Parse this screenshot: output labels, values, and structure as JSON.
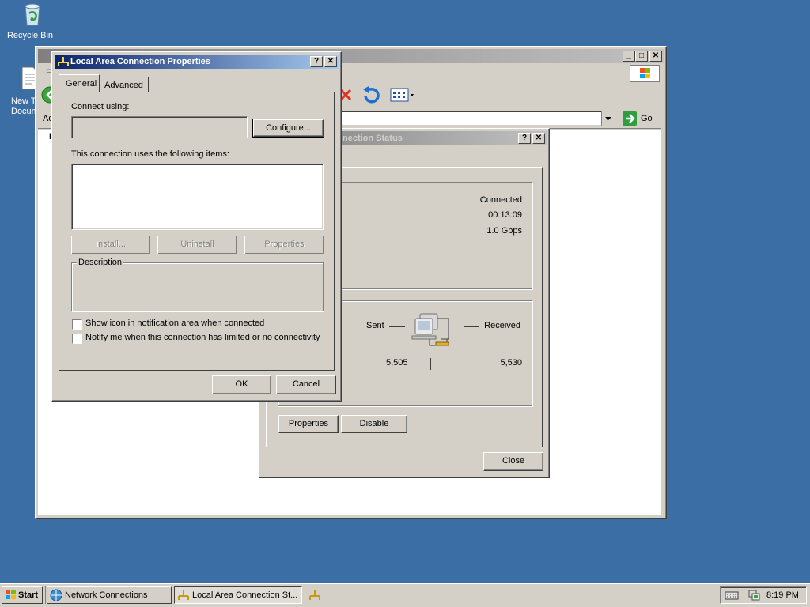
{
  "desktop": {
    "icons": [
      {
        "label": "Recycle Bin",
        "icon": "recycle-bin-icon"
      },
      {
        "label": "New T",
        "label2": "Docum",
        "icon": "text-document-icon"
      }
    ]
  },
  "explorer": {
    "menu_fragment": "Fi",
    "address_fragment": "Ad",
    "list_fragment": "L",
    "go_label": "Go"
  },
  "status_dialog": {
    "title_fragment": "nection Status",
    "connection": {
      "status": "Connected",
      "duration": "00:13:09",
      "speed": "1.0 Gbps"
    },
    "activity": {
      "sent_label": "Sent",
      "received_label": "Received",
      "sent_value": "5,505",
      "received_value": "5,530"
    },
    "buttons": {
      "properties": "Properties",
      "disable": "Disable",
      "close": "Close"
    }
  },
  "properties_dialog": {
    "title": "Local Area Connection Properties",
    "tabs": [
      "General",
      "Advanced"
    ],
    "connect_using_label": "Connect using:",
    "adapter_value": "",
    "configure_button": "Configure...",
    "items_label": "This connection uses the following items:",
    "buttons": {
      "install": "Install...",
      "uninstall": "Uninstall",
      "properties": "Properties",
      "ok": "OK",
      "cancel": "Cancel"
    },
    "description_label": "Description",
    "checkboxes": [
      {
        "label": "Show icon in notification area when connected",
        "checked": false
      },
      {
        "label": "Notify me when this connection has limited or no connectivity",
        "checked": false
      }
    ]
  },
  "taskbar": {
    "start_label": "Start",
    "buttons": [
      {
        "label": "Network Connections",
        "icon": "network-connections-icon"
      },
      {
        "label": "Local Area Connection St...",
        "icon": "network-connection-icon"
      }
    ],
    "clock": "8:19 PM"
  }
}
